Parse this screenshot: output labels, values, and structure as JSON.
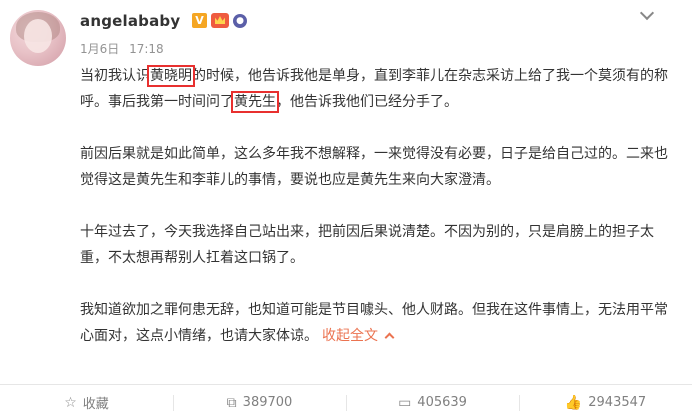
{
  "post": {
    "author": "angelababy",
    "date": "1月6日",
    "time": "17:18",
    "paragraphs": [
      {
        "seg1": "当初我认识",
        "hl1": "黄晓明",
        "seg2": "的时候，他告诉我他是单身，直到李菲儿在杂志采访上给了我一个莫须有的称呼。事后我第一时间问了",
        "hl2": "黄先生",
        "seg3": "，他告诉我他们已经分手了。"
      },
      {
        "text": "前因后果就是如此简单，这么多年我不想解释，一来觉得没有必要，日子是给自己过的。二来也觉得这是黄先生和李菲儿的事情，要说也应是黄先生来向大家澄清。"
      },
      {
        "text": "十年过去了，今天我选择自己站出来，把前因后果说清楚。不因为别的，只是肩膀上的担子太重，不太想再帮别人扛着这口锅了。"
      },
      {
        "text": "我知道欲加之罪何患无辞，也知道可能是节目噱头、他人财路。但我在这件事情上，无法用平常心面对，这点小情绪，也请大家体谅。"
      }
    ],
    "collapse_label": "收起全文"
  },
  "actions": {
    "favorite_label": "收藏",
    "repost_count": "389700",
    "comment_count": "405639",
    "like_count": "2943547"
  },
  "colors": {
    "highlight_box": "#e8302f",
    "link": "#eb7350",
    "badge_v": "#f5a623"
  }
}
